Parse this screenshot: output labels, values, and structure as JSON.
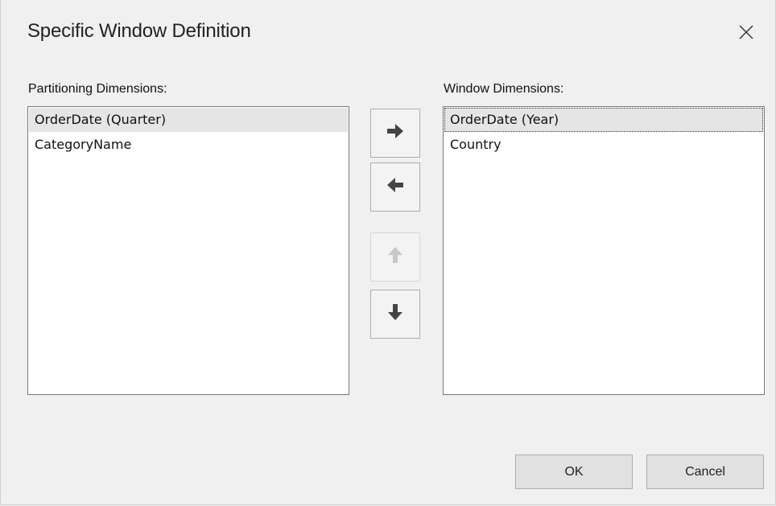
{
  "window": {
    "title": "Specific Window Definition"
  },
  "partitioning": {
    "label": "Partitioning Dimensions:",
    "items": [
      "OrderDate (Quarter)",
      "CategoryName"
    ],
    "selected_index": 0
  },
  "window_dimensions": {
    "label": "Window Dimensions:",
    "items": [
      "OrderDate (Year)",
      "Country"
    ],
    "selected_index": 0
  },
  "move_buttons": {
    "right_icon": "arrow-right-icon",
    "left_icon": "arrow-left-icon",
    "up_icon": "arrow-up-icon",
    "down_icon": "arrow-down-icon",
    "up_enabled": false
  },
  "footer": {
    "ok_label": "OK",
    "cancel_label": "Cancel"
  },
  "colors": {
    "background": "#f0f0f0",
    "arrow_enabled": "#444444",
    "arrow_disabled": "#c8c8c8",
    "selection": "#e5e5e5"
  }
}
